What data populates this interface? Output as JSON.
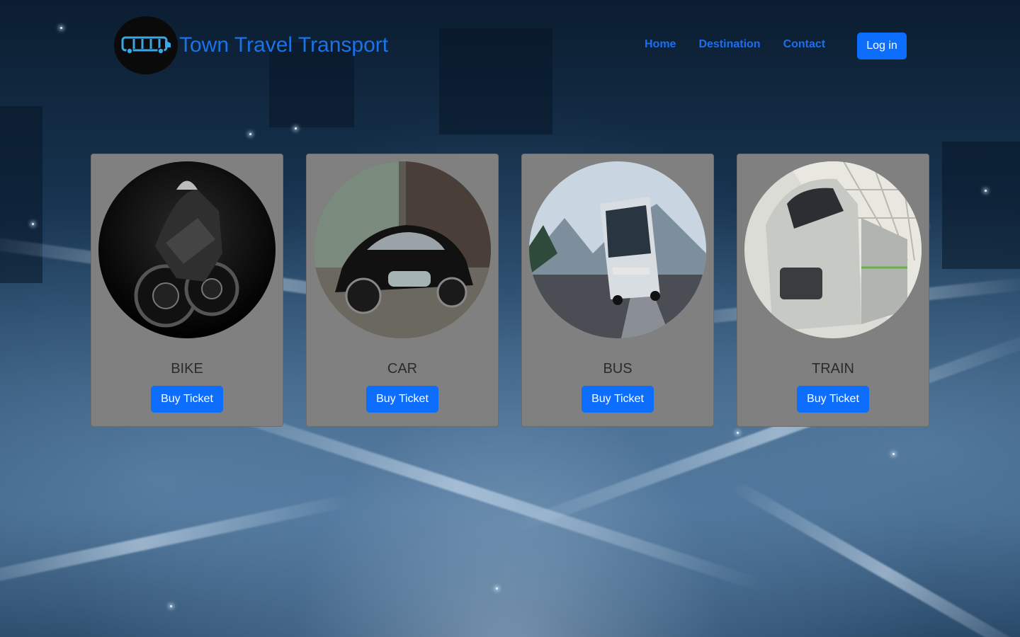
{
  "brand": {
    "title": "Town Travel Transport",
    "logo_icon": "bus-icon"
  },
  "nav": {
    "items": [
      {
        "label": "Home"
      },
      {
        "label": "Destination"
      },
      {
        "label": "Contact"
      }
    ],
    "login_label": "Log in"
  },
  "cards": [
    {
      "title": "BIKE",
      "button": "Buy Ticket",
      "image_icon": "motorcycle-photo"
    },
    {
      "title": "CAR",
      "button": "Buy Ticket",
      "image_icon": "car-photo"
    },
    {
      "title": "BUS",
      "button": "Buy Ticket",
      "image_icon": "bus-photo"
    },
    {
      "title": "TRAIN",
      "button": "Buy Ticket",
      "image_icon": "train-photo"
    }
  ],
  "colors": {
    "accent": "#0d6efd",
    "brand_text": "#1a73e8",
    "card_bg": "#808080"
  }
}
